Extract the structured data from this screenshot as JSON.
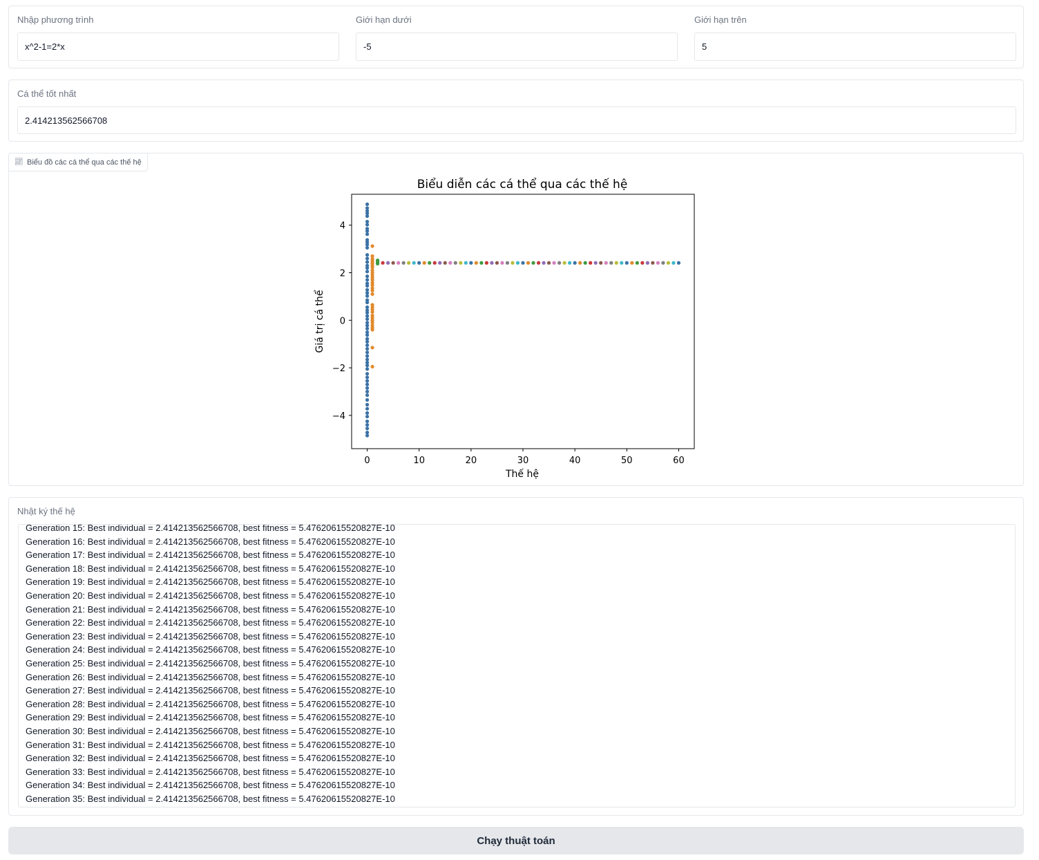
{
  "inputs": {
    "equation": {
      "label": "Nhập phương trình",
      "value": "x^2-1=2*x"
    },
    "lower": {
      "label": "Giới hạn dưới",
      "value": "-5"
    },
    "upper": {
      "label": "Giới hạn trên",
      "value": "5"
    }
  },
  "best": {
    "label": "Cá thể tốt nhất",
    "value": "2.414213562566708"
  },
  "plot": {
    "tab_label": "Biểu đồ các cá thể qua các thế hệ",
    "tab_icon": "chart-icon"
  },
  "chart_data": {
    "type": "scatter",
    "title": "Biểu diễn các cá thể qua các thế hệ",
    "xlabel": "Thế hệ",
    "ylabel": "Giá trị cá thể",
    "xlim": [
      -3,
      63
    ],
    "ylim": [
      -5.4,
      5.3
    ],
    "xticks": [
      0,
      10,
      20,
      30,
      40,
      50,
      60
    ],
    "yticks": [
      -4,
      -2,
      0,
      2,
      4
    ],
    "grid": false,
    "series": [
      {
        "x": 0,
        "color": "#3b72a6",
        "values": [
          4.88,
          4.72,
          4.6,
          4.5,
          4.38,
          4.15,
          4.02,
          3.85,
          3.75,
          3.62,
          3.38,
          3.28,
          3.18,
          3.05,
          2.75,
          2.6,
          2.45,
          2.3,
          2.2,
          2.05,
          1.85,
          1.7,
          1.55,
          1.45,
          1.28,
          1.15,
          1.02,
          0.85,
          0.75,
          0.55,
          0.42,
          0.32,
          0.18,
          0.05,
          -0.1,
          -0.22,
          -0.35,
          -0.5,
          -0.62,
          -0.78,
          -0.9,
          -1.05,
          -1.2,
          -1.35,
          -1.5,
          -1.65,
          -1.78,
          -1.9,
          -2.05,
          -2.25,
          -2.4,
          -2.55,
          -2.7,
          -2.85,
          -3.0,
          -3.15,
          -3.35,
          -3.55,
          -3.72,
          -3.9,
          -4.05,
          -4.25,
          -4.4,
          -4.55,
          -4.72,
          -4.85
        ]
      },
      {
        "x": 1,
        "color": "#e08a2c",
        "values": [
          3.12,
          2.7,
          2.58,
          2.5,
          2.42,
          2.38,
          2.3,
          2.22,
          2.1,
          2.0,
          1.9,
          1.8,
          1.7,
          1.58,
          1.48,
          1.35,
          1.25,
          1.1,
          0.65,
          0.55,
          0.45,
          0.35,
          0.2,
          0.1,
          0.0,
          -0.1,
          -0.22,
          -0.32,
          -0.4,
          -1.15,
          -1.95
        ]
      },
      {
        "x": 2,
        "color": "#3f9a3f",
        "values": [
          2.52,
          2.45,
          2.38
        ]
      }
    ],
    "converged_value": 2.414213562566708,
    "converged_from_generation": 3,
    "converged_to_generation": 60
  },
  "log": {
    "label": "Nhật ký thế hệ",
    "lines": [
      "Generation 15: Best individual = 2.414213562566708, best fitness = 5.47620615520827E-10",
      "Generation 16: Best individual = 2.414213562566708, best fitness = 5.47620615520827E-10",
      "Generation 17: Best individual = 2.414213562566708, best fitness = 5.47620615520827E-10",
      "Generation 18: Best individual = 2.414213562566708, best fitness = 5.47620615520827E-10",
      "Generation 19: Best individual = 2.414213562566708, best fitness = 5.47620615520827E-10",
      "Generation 20: Best individual = 2.414213562566708, best fitness = 5.47620615520827E-10",
      "Generation 21: Best individual = 2.414213562566708, best fitness = 5.47620615520827E-10",
      "Generation 22: Best individual = 2.414213562566708, best fitness = 5.47620615520827E-10",
      "Generation 23: Best individual = 2.414213562566708, best fitness = 5.47620615520827E-10",
      "Generation 24: Best individual = 2.414213562566708, best fitness = 5.47620615520827E-10",
      "Generation 25: Best individual = 2.414213562566708, best fitness = 5.47620615520827E-10",
      "Generation 26: Best individual = 2.414213562566708, best fitness = 5.47620615520827E-10",
      "Generation 27: Best individual = 2.414213562566708, best fitness = 5.47620615520827E-10",
      "Generation 28: Best individual = 2.414213562566708, best fitness = 5.47620615520827E-10",
      "Generation 29: Best individual = 2.414213562566708, best fitness = 5.47620615520827E-10",
      "Generation 30: Best individual = 2.414213562566708, best fitness = 5.47620615520827E-10",
      "Generation 31: Best individual = 2.414213562566708, best fitness = 5.47620615520827E-10",
      "Generation 32: Best individual = 2.414213562566708, best fitness = 5.47620615520827E-10",
      "Generation 33: Best individual = 2.414213562566708, best fitness = 5.47620615520827E-10",
      "Generation 34: Best individual = 2.414213562566708, best fitness = 5.47620615520827E-10",
      "Generation 35: Best individual = 2.414213562566708, best fitness = 5.47620615520827E-10"
    ]
  },
  "run_button": {
    "label": "Chạy thuật toán"
  }
}
